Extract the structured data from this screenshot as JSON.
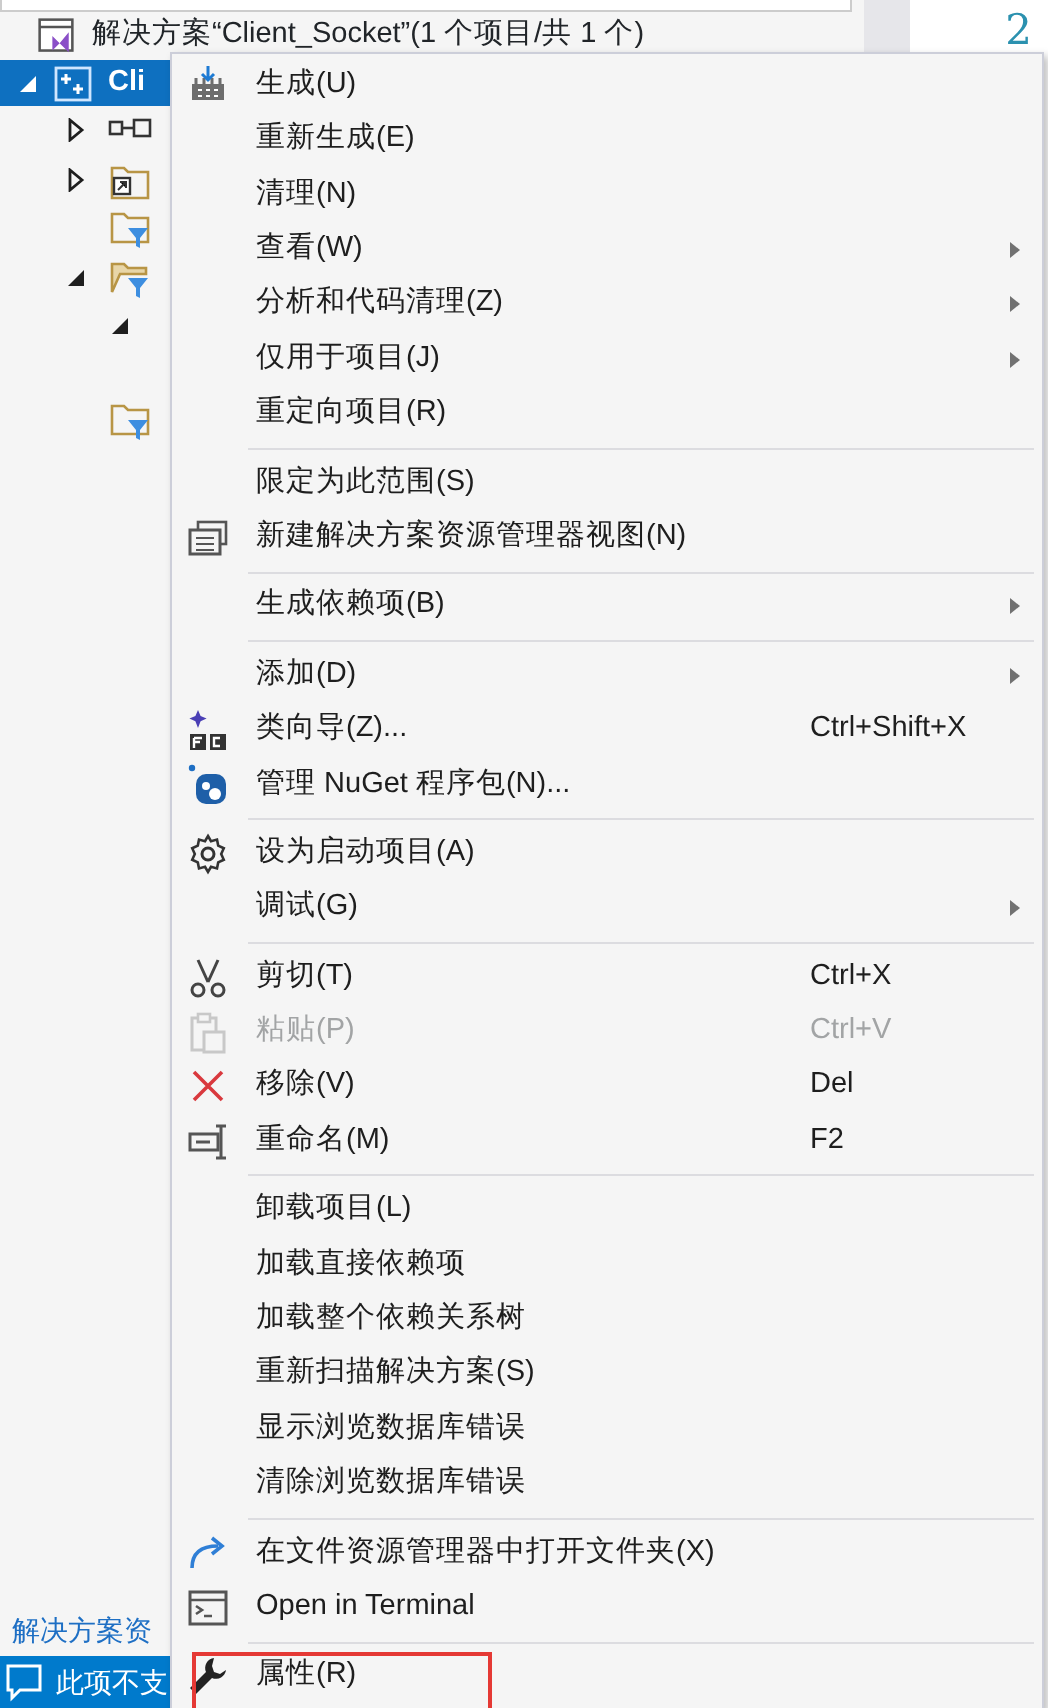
{
  "editor": {
    "line_number": "2"
  },
  "solution_explorer": {
    "solution": "解决方案“Client_Socket”(1 个项目/共 1 个)",
    "project": {
      "label": "Cli",
      "selected": true,
      "expanded": true,
      "children": [
        {
          "kind": "references",
          "expanded": false
        },
        {
          "kind": "shortcut-folder",
          "expanded": false
        },
        {
          "kind": "filter-folder"
        },
        {
          "kind": "open-filter-folder",
          "expanded": true,
          "children": [
            {
              "expanded": true
            }
          ]
        },
        {
          "kind": "filter-folder"
        }
      ]
    },
    "footer_link": "解决方案资"
  },
  "status_bar": {
    "text": "此项不支"
  },
  "context_menu": {
    "groups": [
      [
        {
          "label": "生成(U)",
          "submenu": false,
          "disabled": false,
          "highlighted": false
        },
        {
          "label": "重新生成(E)",
          "submenu": false,
          "disabled": false,
          "highlighted": false
        },
        {
          "label": "清理(N)",
          "submenu": false,
          "disabled": false,
          "highlighted": false
        },
        {
          "label": "查看(W)",
          "submenu": true,
          "disabled": false,
          "highlighted": false
        },
        {
          "label": "分析和代码清理(Z)",
          "submenu": true,
          "disabled": false,
          "highlighted": false
        },
        {
          "label": "仅用于项目(J)",
          "submenu": true,
          "disabled": false,
          "highlighted": false
        },
        {
          "label": "重定向项目(R)",
          "submenu": false,
          "disabled": false,
          "highlighted": false
        }
      ],
      [
        {
          "label": "限定为此范围(S)",
          "submenu": false,
          "disabled": false,
          "highlighted": false
        },
        {
          "label": "新建解决方案资源管理器视图(N)",
          "submenu": false,
          "disabled": false,
          "highlighted": false
        }
      ],
      [
        {
          "label": "生成依赖项(B)",
          "submenu": true,
          "disabled": false,
          "highlighted": false
        }
      ],
      [
        {
          "label": "添加(D)",
          "submenu": true,
          "disabled": false,
          "highlighted": false
        },
        {
          "label": "类向导(Z)...",
          "shortcut": "Ctrl+Shift+X",
          "submenu": false,
          "disabled": false,
          "highlighted": false
        },
        {
          "label": "管理 NuGet 程序包(N)...",
          "submenu": false,
          "disabled": false,
          "highlighted": false
        }
      ],
      [
        {
          "label": "设为启动项目(A)",
          "submenu": false,
          "disabled": false,
          "highlighted": false
        },
        {
          "label": "调试(G)",
          "submenu": true,
          "disabled": false,
          "highlighted": false
        }
      ],
      [
        {
          "label": "剪切(T)",
          "shortcut": "Ctrl+X",
          "submenu": false,
          "disabled": false,
          "highlighted": false
        },
        {
          "label": "粘贴(P)",
          "shortcut": "Ctrl+V",
          "submenu": false,
          "disabled": true,
          "highlighted": false
        },
        {
          "label": "移除(V)",
          "shortcut": "Del",
          "submenu": false,
          "disabled": false,
          "highlighted": false
        },
        {
          "label": "重命名(M)",
          "shortcut": "F2",
          "submenu": false,
          "disabled": false,
          "highlighted": false
        }
      ],
      [
        {
          "label": "卸载项目(L)",
          "submenu": false,
          "disabled": false,
          "highlighted": false
        },
        {
          "label": "加载直接依赖项",
          "submenu": false,
          "disabled": false,
          "highlighted": false
        },
        {
          "label": "加载整个依赖关系树",
          "submenu": false,
          "disabled": false,
          "highlighted": false
        },
        {
          "label": "重新扫描解决方案(S)",
          "submenu": false,
          "disabled": false,
          "highlighted": false
        },
        {
          "label": "显示浏览数据库错误",
          "submenu": false,
          "disabled": false,
          "highlighted": false
        },
        {
          "label": "清除浏览数据库错误",
          "submenu": false,
          "disabled": false,
          "highlighted": false
        }
      ],
      [
        {
          "label": "在文件资源管理器中打开文件夹(X)",
          "submenu": false,
          "disabled": false,
          "highlighted": false
        },
        {
          "label": "Open in Terminal",
          "submenu": false,
          "disabled": false,
          "highlighted": false
        }
      ],
      [
        {
          "label": "属性(R)",
          "submenu": false,
          "disabled": false,
          "highlighted": true
        }
      ]
    ]
  }
}
